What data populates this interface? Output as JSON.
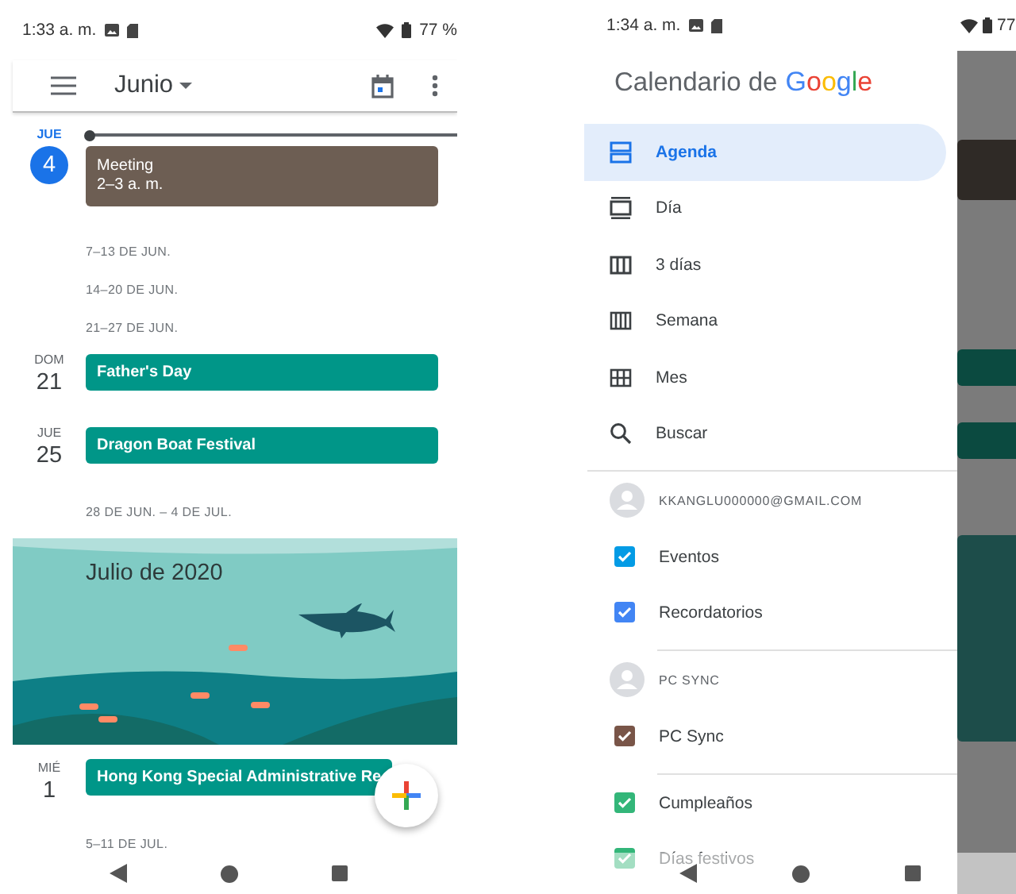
{
  "left_screen": {
    "status_bar": {
      "time": "1:33 a. m.",
      "battery": "77 %"
    },
    "toolbar": {
      "title": "Junio"
    },
    "agenda": [
      {
        "kind": "day",
        "weekday": "JUE",
        "day": "4",
        "today": true,
        "events": [
          {
            "title": "Meeting",
            "time": "2–3 a. m.",
            "color": "#6d5e53"
          }
        ]
      },
      {
        "kind": "week",
        "label": "7–13 DE JUN."
      },
      {
        "kind": "week",
        "label": "14–20 DE JUN."
      },
      {
        "kind": "week",
        "label": "21–27 DE JUN."
      },
      {
        "kind": "day",
        "weekday": "DOM",
        "day": "21",
        "today": false,
        "events": [
          {
            "title": "Father's Day",
            "color": "#009688"
          }
        ]
      },
      {
        "kind": "day",
        "weekday": "JUE",
        "day": "25",
        "today": false,
        "events": [
          {
            "title": "Dragon Boat Festival",
            "color": "#009688"
          }
        ]
      },
      {
        "kind": "week",
        "label": "28 DE JUN. – 4 DE JUL."
      },
      {
        "kind": "banner",
        "title": "Julio de 2020"
      },
      {
        "kind": "day",
        "weekday": "MIÉ",
        "day": "1",
        "today": false,
        "events": [
          {
            "title": "Hong Kong Special Administrative Re",
            "color": "#009688"
          }
        ]
      },
      {
        "kind": "week",
        "label": "5–11 DE JUL."
      }
    ]
  },
  "right_screen": {
    "status_bar": {
      "time": "1:34 a. m.",
      "battery": "77"
    },
    "drawer": {
      "title": "Calendario de",
      "logo": "Google",
      "views": [
        {
          "kind": "agenda",
          "label": "Agenda",
          "selected": true
        },
        {
          "kind": "day",
          "label": "Día",
          "selected": false
        },
        {
          "kind": "three_day",
          "label": "3 días",
          "selected": false
        },
        {
          "kind": "week",
          "label": "Semana",
          "selected": false
        },
        {
          "kind": "month",
          "label": "Mes",
          "selected": false
        },
        {
          "kind": "search",
          "label": "Buscar",
          "selected": false
        }
      ],
      "groups": [
        {
          "account": "KKANGLU000000@GMAIL.COM",
          "calendars": [
            {
              "label": "Eventos",
              "checked": true,
              "color": "#039be5"
            },
            {
              "label": "Recordatorios",
              "checked": true,
              "color": "#4285f4"
            }
          ]
        },
        {
          "account": "PC SYNC",
          "calendars": [
            {
              "label": "PC Sync",
              "checked": true,
              "color": "#795548"
            }
          ]
        },
        {
          "calendars": [
            {
              "label": "Cumpleaños",
              "checked": true,
              "color": "#33b679"
            },
            {
              "label": "Días festivos",
              "checked": true,
              "color": "#33b679"
            }
          ]
        }
      ]
    }
  }
}
